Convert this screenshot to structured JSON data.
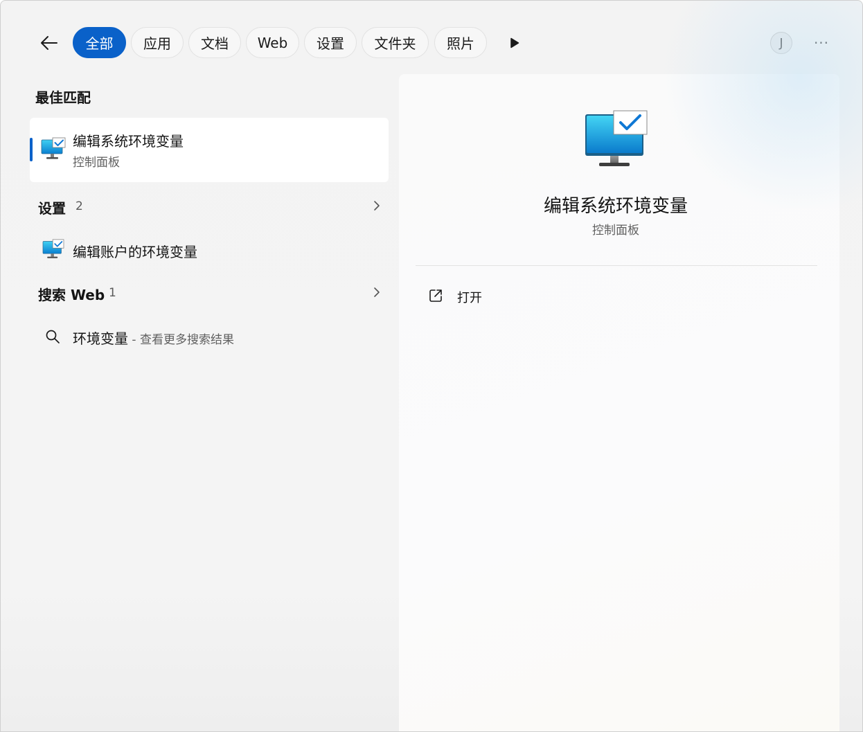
{
  "toolbar": {
    "back_icon": "arrow-left-icon",
    "tabs": [
      {
        "label": "全部",
        "active": true
      },
      {
        "label": "应用",
        "active": false
      },
      {
        "label": "文档",
        "active": false
      },
      {
        "label": "Web",
        "active": false
      },
      {
        "label": "设置",
        "active": false
      },
      {
        "label": "文件夹",
        "active": false
      },
      {
        "label": "照片",
        "active": false
      }
    ],
    "more_icon": "play-triangle-icon",
    "avatar_initial": "J",
    "overflow_label": "···"
  },
  "results": {
    "best_match": {
      "heading": "最佳匹配",
      "title": "编辑系统环境变量",
      "subtitle": "控制面板",
      "icon": "system-properties-monitor-icon"
    },
    "settings_group": {
      "title": "设置",
      "count": "2"
    },
    "settings_item": {
      "label": "编辑账户的环境变量",
      "icon": "system-properties-monitor-icon"
    },
    "web_group": {
      "title": "搜索 Web",
      "count": "1"
    },
    "web_item": {
      "query": "环境变量",
      "hint": " - 查看更多搜索结果",
      "icon": "search-icon"
    }
  },
  "preview": {
    "title": "编辑系统环境变量",
    "subtitle": "控制面板",
    "actions": [
      {
        "label": "打开",
        "icon": "open-external-icon"
      }
    ]
  },
  "colors": {
    "accent": "#0a61c9",
    "window_bg": "#f3f3f3",
    "preview_bg": "#fafafa"
  }
}
